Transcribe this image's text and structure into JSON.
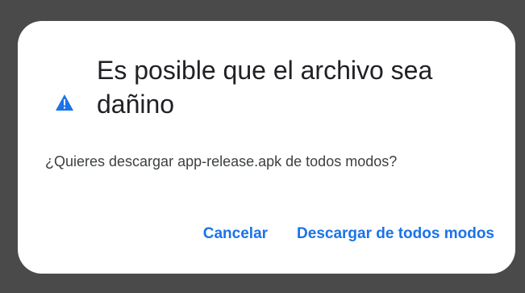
{
  "dialog": {
    "title": "Es posible que el archivo sea dañino",
    "message": "¿Quieres descargar app-release.apk de todos modos?",
    "icon": "warning-triangle-icon",
    "icon_color": "#1a73e8"
  },
  "actions": {
    "cancel_label": "Cancelar",
    "download_label": "Descargar de todos modos"
  },
  "colors": {
    "accent": "#1a73e8",
    "backdrop": "#4a4a4a",
    "dialog_bg": "#ffffff"
  }
}
